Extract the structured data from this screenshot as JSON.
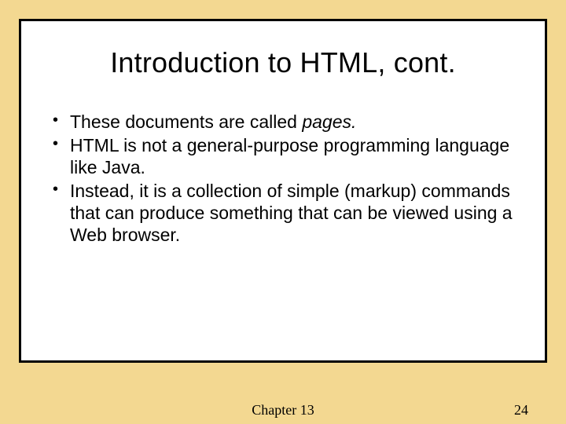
{
  "slide": {
    "title": "Introduction to HTML, cont.",
    "bullets": [
      {
        "pre": "These documents are called ",
        "em": "pages.",
        "post": ""
      },
      {
        "pre": "HTML is not a general-purpose programming language like Java.",
        "em": "",
        "post": ""
      },
      {
        "pre": "Instead, it is a collection of simple (markup) commands that can produce something that can be viewed using a Web browser.",
        "em": "",
        "post": ""
      }
    ]
  },
  "footer": {
    "center": "Chapter 13",
    "page": "24"
  }
}
